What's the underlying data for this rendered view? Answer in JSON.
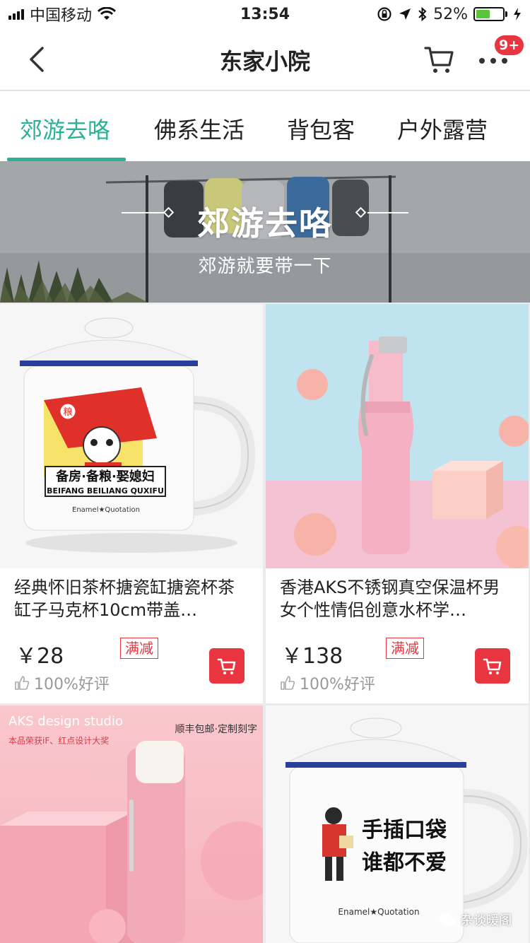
{
  "status_bar": {
    "carrier": "中国移动",
    "time": "13:54",
    "battery": "52%",
    "battery_level": 0.52
  },
  "nav": {
    "title": "东家小院",
    "badge": "9+"
  },
  "tabs": [
    {
      "label": "郊游去咯",
      "active": true
    },
    {
      "label": "佛系生活",
      "active": false
    },
    {
      "label": "背包客",
      "active": false
    },
    {
      "label": "户外露营",
      "active": false
    }
  ],
  "banner": {
    "title": "郊游去咯",
    "subtitle": "郊游就要带一下"
  },
  "products": [
    {
      "title": "经典怀旧茶杯搪瓷缸搪瓷杯茶缸子马克杯10cm带盖…",
      "price": "￥28",
      "tag": "满减",
      "rating": "100%好评",
      "image": {
        "text_main": "备房·备粮·娶媳妇",
        "text_pinyin": "BEIFANG BEILIANG QUXIFU",
        "brand": "Enamel★Quotation",
        "flag_char": "粮"
      }
    },
    {
      "title": "香港AKS不锈钢真空保温杯男女个性情侣创意水杯学…",
      "price": "￥138",
      "tag": "满减",
      "rating": "100%好评"
    },
    {
      "image": {
        "brand": "AKS design studio",
        "award": "本品荣获iF、红点设计大奖",
        "service": "顺丰包邮·定制刻字"
      }
    },
    {
      "image": {
        "line1": "手插口袋",
        "line2": "谁都不爱",
        "brand": "Enamel★Quotation"
      }
    }
  ],
  "watermark": "杂谈暖阁",
  "colors": {
    "accent": "#2bb296",
    "red": "#e9353f",
    "cart_badge": "#e9353f"
  }
}
